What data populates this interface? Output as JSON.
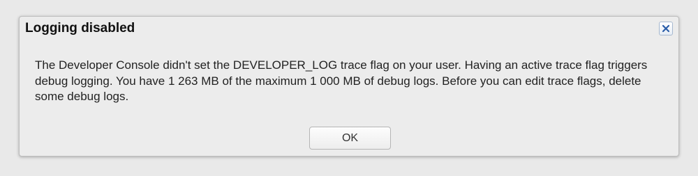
{
  "dialog": {
    "title": "Logging disabled",
    "close_icon": "close-icon",
    "message": "The Developer Console didn't set the DEVELOPER_LOG trace flag on your user. Having an active trace flag triggers debug logging. You have 1 263 MB of the maximum 1 000 MB of debug logs. Before you can edit trace flags, delete some debug logs.",
    "ok_label": "OK"
  },
  "colors": {
    "background": "#e9e9e9",
    "dialog_background": "#ececec",
    "close_icon": "#2a5da8"
  }
}
